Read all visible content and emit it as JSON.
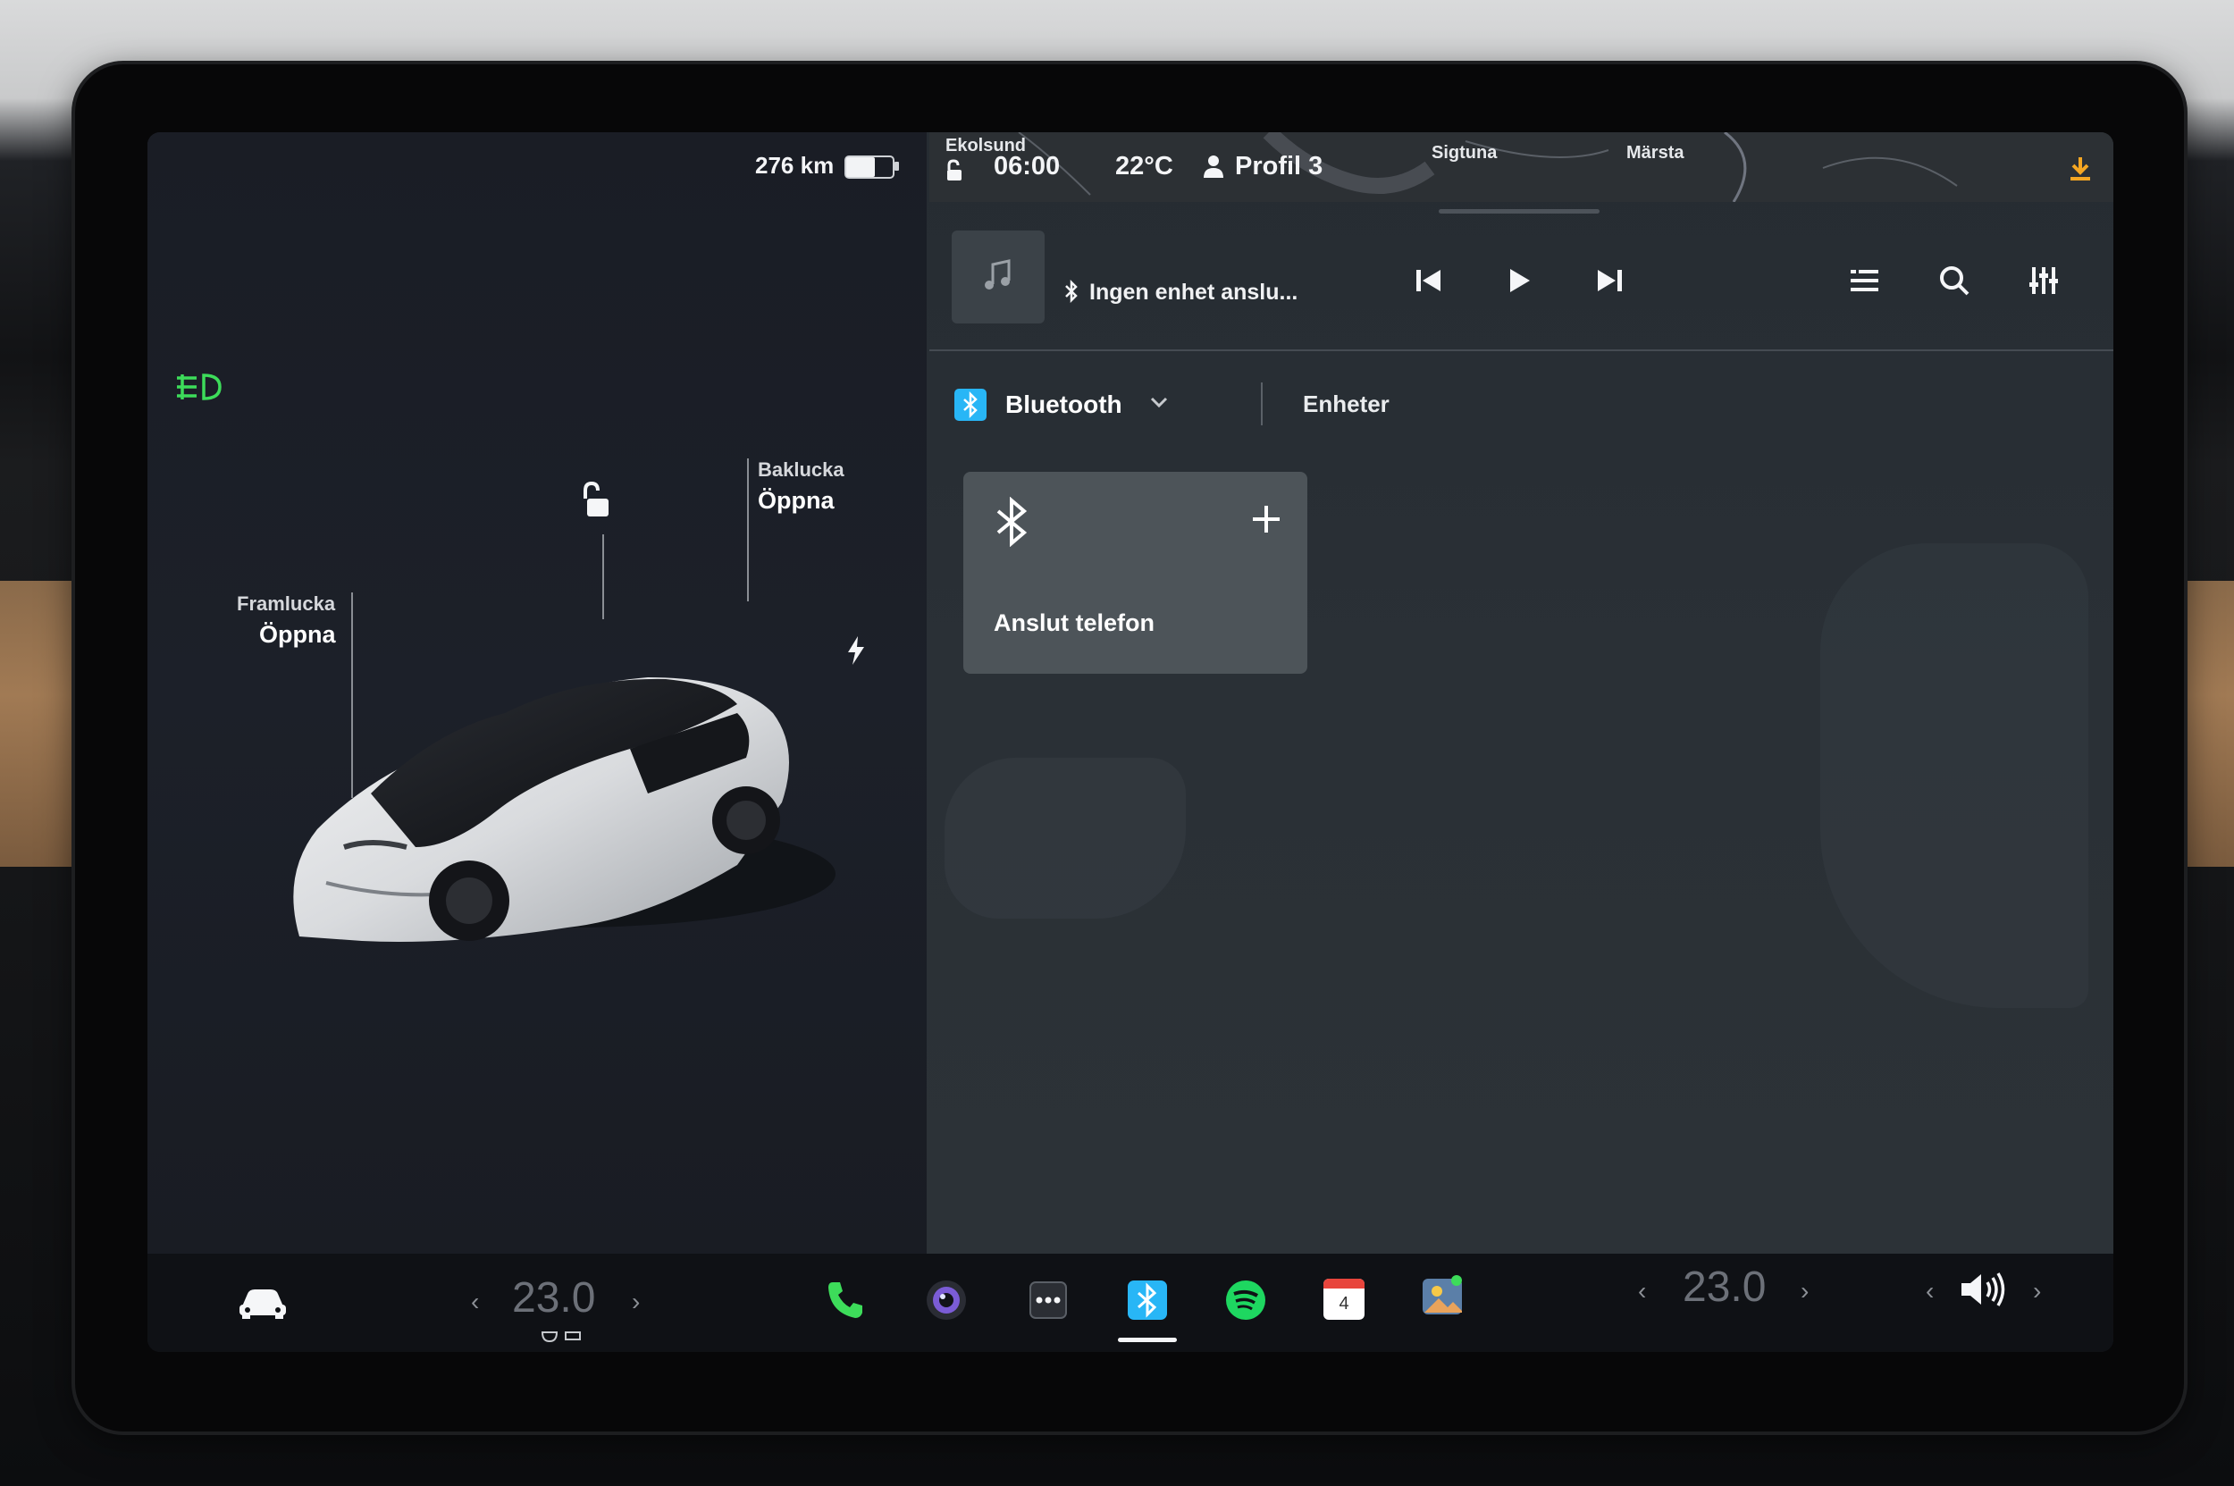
{
  "status": {
    "range": "276 km",
    "battery_level": 0.62,
    "time": "06:00",
    "temperature": "22°C",
    "profile": "Profil 3",
    "map_places": [
      "Ekolsund",
      "Sigtuna",
      "Märsta"
    ]
  },
  "car": {
    "frunk_label": "Framlucka",
    "frunk_action": "Öppna",
    "trunk_label": "Baklucka",
    "trunk_action": "Öppna"
  },
  "media": {
    "source_status": "Ingen enhet anslu...",
    "source_tab": "Bluetooth",
    "devices_tab": "Enheter",
    "connect_card_label": "Anslut telefon"
  },
  "climate": {
    "driver_temp": "23.0",
    "passenger_temp": "23.0"
  },
  "dock": {
    "calendar_day": "4",
    "apps": [
      "car-icon",
      "phone-icon",
      "camera-icon",
      "more-icon",
      "bluetooth-icon",
      "spotify-icon",
      "calendar-icon",
      "photos-icon",
      "volume-icon"
    ]
  },
  "colors": {
    "accent_green": "#3ddc5a",
    "bluetooth_blue": "#28b6f6",
    "spotify_green": "#1ed760",
    "download_orange": "#f5a623"
  }
}
